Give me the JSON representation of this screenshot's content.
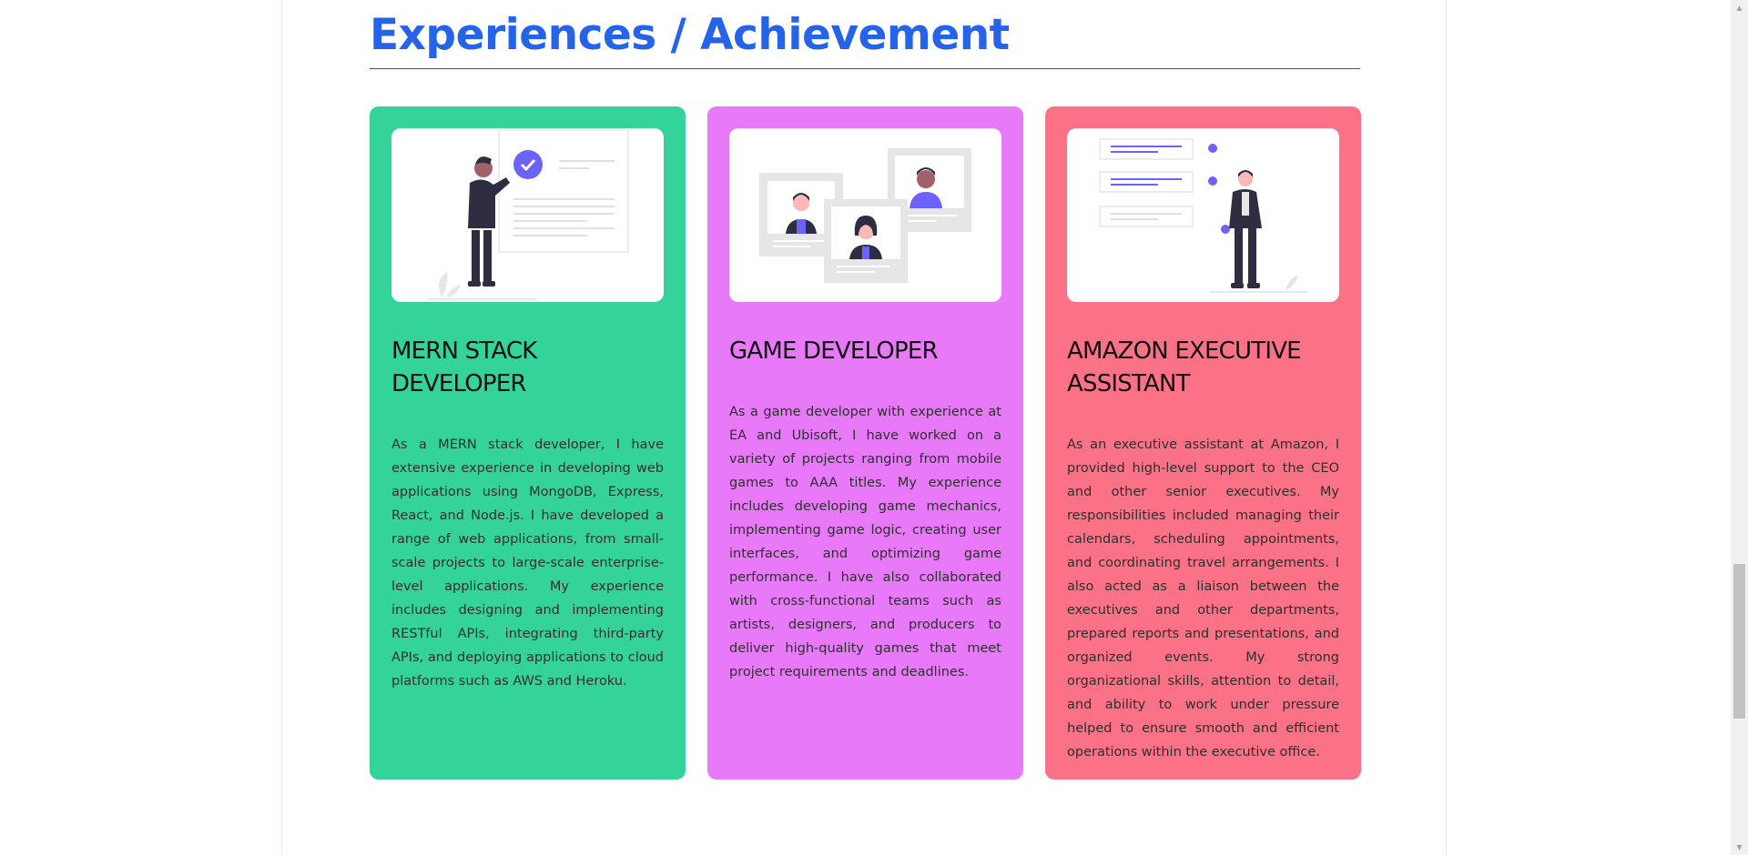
{
  "section": {
    "title": "Experiences / Achievement"
  },
  "cards": [
    {
      "title": "MERN STACK DEVELOPER",
      "description": "As a MERN stack developer, I have extensive experience in developing web applications using MongoDB, Express, React, and Node.js. I have developed a range of web applications, from small-scale projects to large-scale enterprise-level applications. My experience includes designing and implementing RESTful APIs, integrating third-party APIs, and deploying applications to cloud platforms such as AWS and Heroku.",
      "color": "#34d399",
      "illustration": "person-presenting-checklist-illustration"
    },
    {
      "title": "GAME DEVELOPER",
      "description": "As a game developer with experience at EA and Ubisoft, I have worked on a variety of projects ranging from mobile games to AAA titles. My experience includes developing game mechanics, implementing game logic, creating user interfaces, and optimizing game performance. I have also collaborated with cross-functional teams such as artists, designers, and producers to deliver high-quality games that meet project requirements and deadlines.",
      "color": "#e879f9",
      "illustration": "team-profiles-illustration"
    },
    {
      "title": "AMAZON EXECUTIVE ASSISTANT",
      "description": "As an executive assistant at Amazon, I provided high-level support to the CEO and other senior executives. My responsibilities included managing their calendars, scheduling appointments, and coordinating travel arrangements. I also acted as a liaison between the executives and other departments, prepared reports and presentations, and organized events. My strong organizational skills, attention to detail, and ability to work under pressure helped to ensure smooth and efficient operations within the executive office.",
      "color": "#fb7185",
      "illustration": "person-with-task-list-illustration"
    }
  ],
  "colors": {
    "title": "#2563eb",
    "accent": "#6c63ff"
  },
  "scrollbar": {
    "position": 0.78
  }
}
